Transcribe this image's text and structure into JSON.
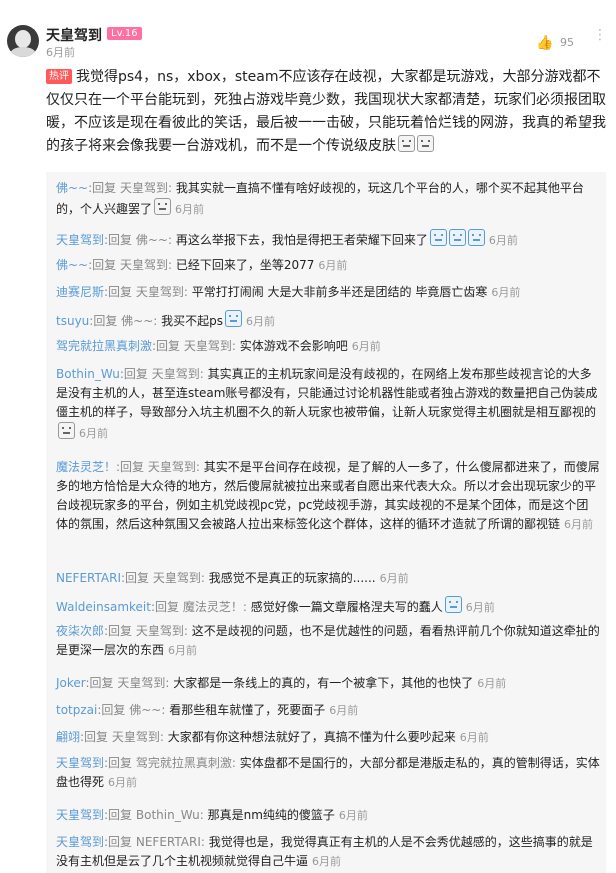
{
  "header": {
    "username": "天皇驾到",
    "level": "Lv.16",
    "time": "6月前",
    "like_count": "95"
  },
  "main": {
    "hot_label": "热评",
    "text": "我觉得ps4，ns，xbox，steam不应该存在歧视，大家都是玩游戏，大部分游戏都不仅仅只在一个平台能玩到，死独占游戏毕竟少数，我国现状大家都清楚，玩家们必须报团取暖，不应该是现在看彼此的笑话，最后被一一击破，只能玩着恰烂钱的网游，我真的希望我的孩子将来会像我要一台游戏机，而不是一个传说级皮肤"
  },
  "ui": {
    "reply_word": "回复",
    "sep": ": "
  },
  "replies": [
    {
      "user": "佛~~",
      "to": "天皇驾到",
      "text": "我其实就一直搞不懂有啥好歧视的，玩这几个平台的人，哪个买不起其他平台的，个人兴趣罢了",
      "emojis": [
        "sticker"
      ],
      "time": "6月前"
    },
    {
      "user": "天皇驾到",
      "to": "佛~~",
      "text": "再这么举报下去，我怕是得把王者荣耀下回来了",
      "emojis": [
        "blue",
        "blue",
        "blue"
      ],
      "time": "6月前"
    },
    {
      "user": "佛~~",
      "to": "天皇驾到",
      "text": "已经下回来了，坐等2077",
      "emojis": [],
      "time": "6月前"
    },
    {
      "user": "迪赛尼斯",
      "to": "天皇驾到",
      "text": "平常打打闹闹 大是大非前多半还是团结的 毕竟唇亡齿寒",
      "emojis": [],
      "time": "6月前"
    },
    {
      "user": "tsuyu",
      "to": "佛~~",
      "text": "我买不起ps",
      "emojis": [
        "blue"
      ],
      "time": "6月前"
    },
    {
      "user": "驾完就拉黑真刺激",
      "to": "天皇驾到",
      "text": "实体游戏不会影响吧",
      "emojis": [],
      "time": "6月前"
    },
    {
      "user": "Bothin_Wu",
      "to": "天皇驾到",
      "text": "其实真正的主机玩家间是没有歧视的，在网络上发布那些歧视言论的大多是没有主机的人，甚至连steam账号都没有，只能通过讨论机器性能或者独占游戏的数量把自己伪装成僵主机的样子，导致部分入坑主机圈不久的新人玩家也被带偏，让新人玩家觉得主机圈就是相互鄙视的",
      "emojis": [
        "sticker"
      ],
      "time": "6月前"
    },
    {
      "user": "魔法灵芝！",
      "to": "天皇驾到",
      "text": "其实不是平台间存在歧视，是了解的人一多了，什么傻屌都进来了，而傻屌多的地方恰恰是大众待的地方，然后傻屌就被拉出来或者自愿出来代表大众。所以才会出现玩家少的平台歧视玩家多的平台，例如主机党歧视pc党，pc党歧视手游，其实歧视的不是某个团体，而是这个团体的氛围，然后这种氛围又会被路人拉出来标签化这个群体，这样的循环才造就了所谓的鄙视链",
      "emojis": [],
      "time": "6月前"
    },
    {
      "user": "NEFERTARI",
      "to": "天皇驾到",
      "text": "我感觉不是真正的玩家搞的......",
      "emojis": [],
      "time": "6月前"
    },
    {
      "user": "Waldeinsamkeit",
      "to": "魔法灵芝！",
      "text": "感觉好像一篇文章履格涅夫写的蠢人",
      "emojis": [
        "blue"
      ],
      "time": "6月前"
    },
    {
      "user": "夜柒次郎",
      "to": "天皇驾到",
      "text": "这不是歧视的问题，也不是优越性的问题，看看热评前几个你就知道这牵扯的是更深一层次的东西",
      "emojis": [],
      "time": "6月前"
    },
    {
      "user": "Joker",
      "to": "天皇驾到",
      "text": "大家都是一条线上的真的，有一个被拿下，其他的也快了",
      "emojis": [],
      "time": "6月前"
    },
    {
      "user": "totpzai",
      "to": "佛~~",
      "text": "看那些租车就懂了，死要面子",
      "emojis": [],
      "time": "6月前"
    },
    {
      "user": "翩翊",
      "to": "天皇驾到",
      "text": "大家都有你这种想法就好了，真搞不懂为什么要吵起来",
      "emojis": [],
      "time": "6月前"
    },
    {
      "user": "天皇驾到",
      "to": "驾完就拉黑真刺激",
      "text": "实体盘都不是国行的，大部分都是港版走私的，真的管制得话，实体盘也得死",
      "emojis": [],
      "time": "6月前"
    },
    {
      "user": "天皇驾到",
      "to": "Bothin_Wu",
      "text": "那真是nm纯纯的傻篮子",
      "emojis": [],
      "time": "6月前"
    },
    {
      "user": "天皇驾到",
      "to": "NEFERTARI",
      "text": "我觉得也是，我觉得真正有主机的人是不会秀优越感的，这些搞事的就是没有主机但是云了几个主机视频就觉得自己牛逼",
      "emojis": [],
      "time": "6月前"
    }
  ]
}
